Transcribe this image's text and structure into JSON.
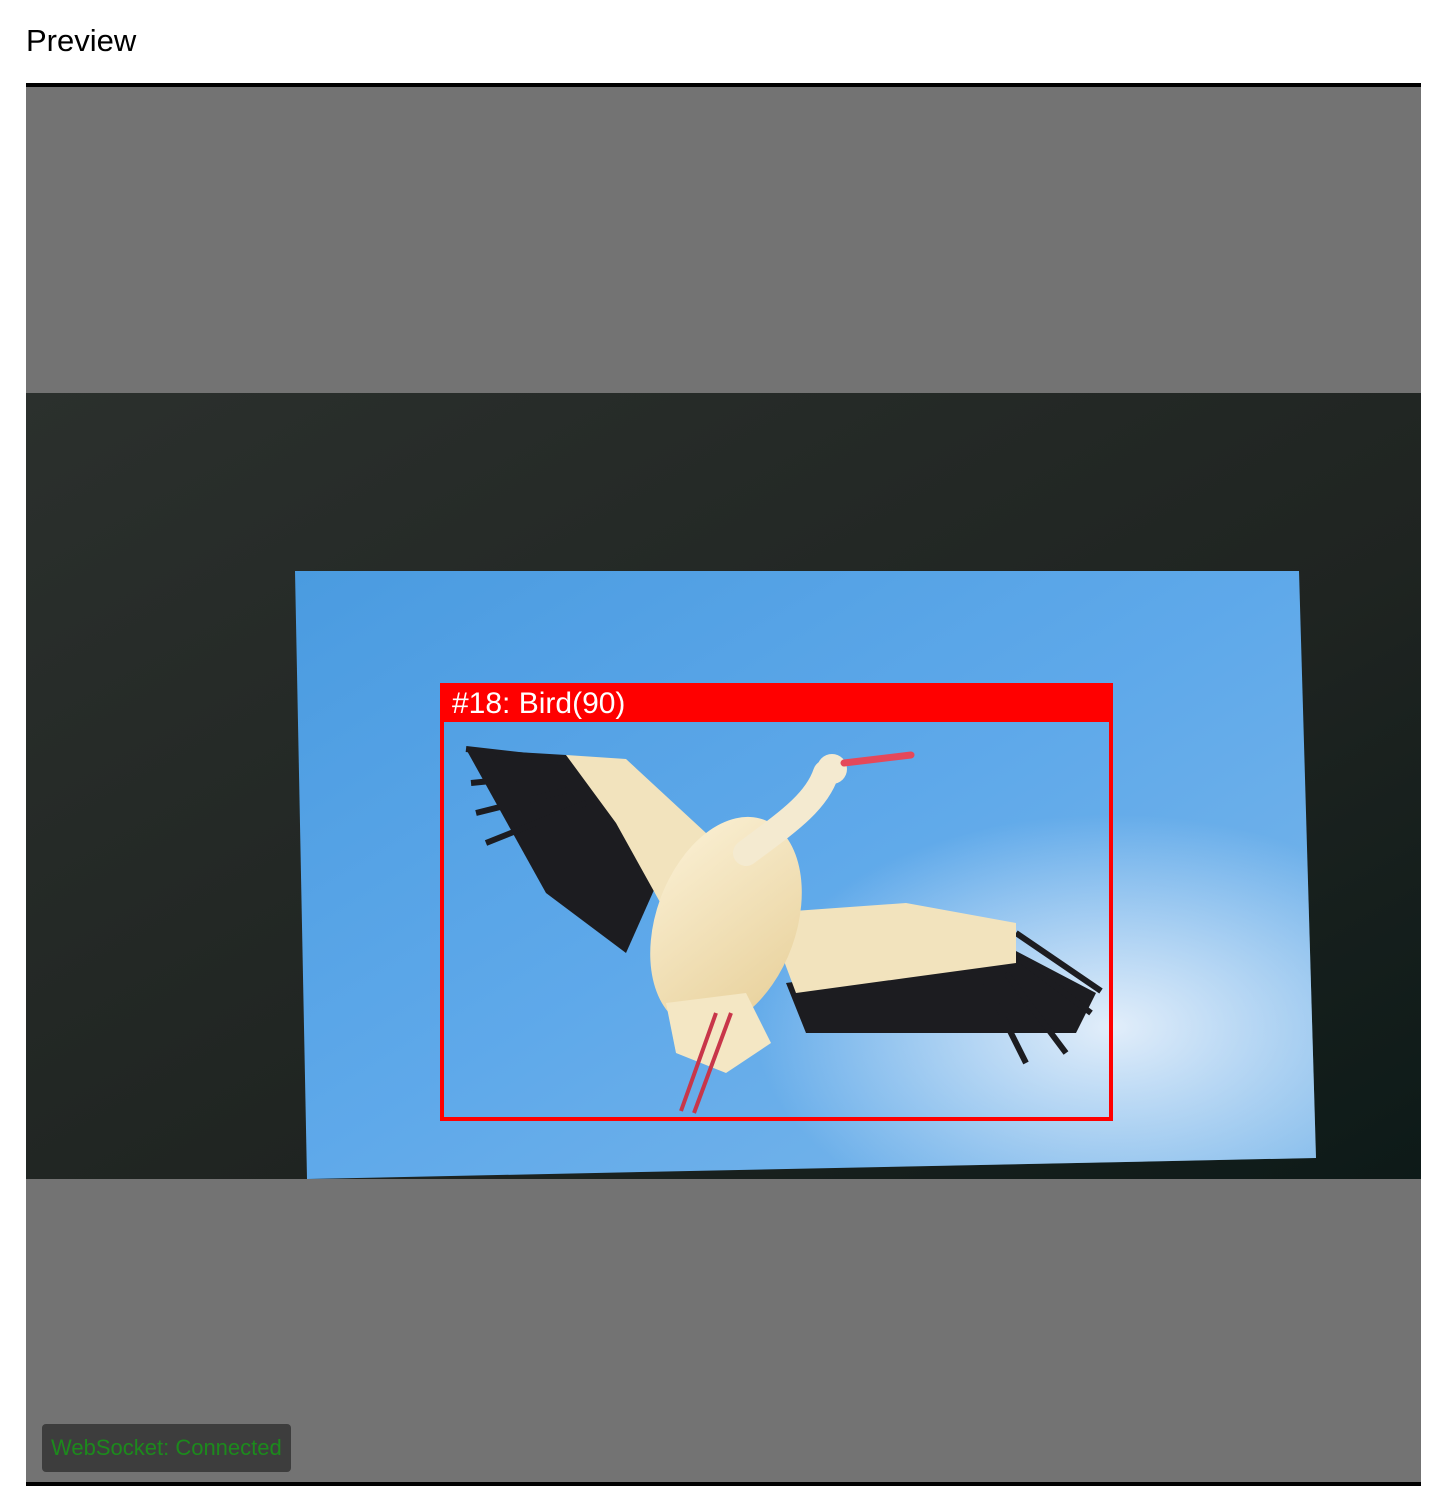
{
  "header": {
    "title": "Preview"
  },
  "preview": {
    "detection": {
      "label": "#18: Bird(90)",
      "track_id": 18,
      "class": "Bird",
      "score": 90,
      "color": "#ff0000"
    },
    "status": {
      "text": "WebSocket: Connected",
      "color": "#1c8a1c"
    },
    "background_color": "#737373"
  }
}
